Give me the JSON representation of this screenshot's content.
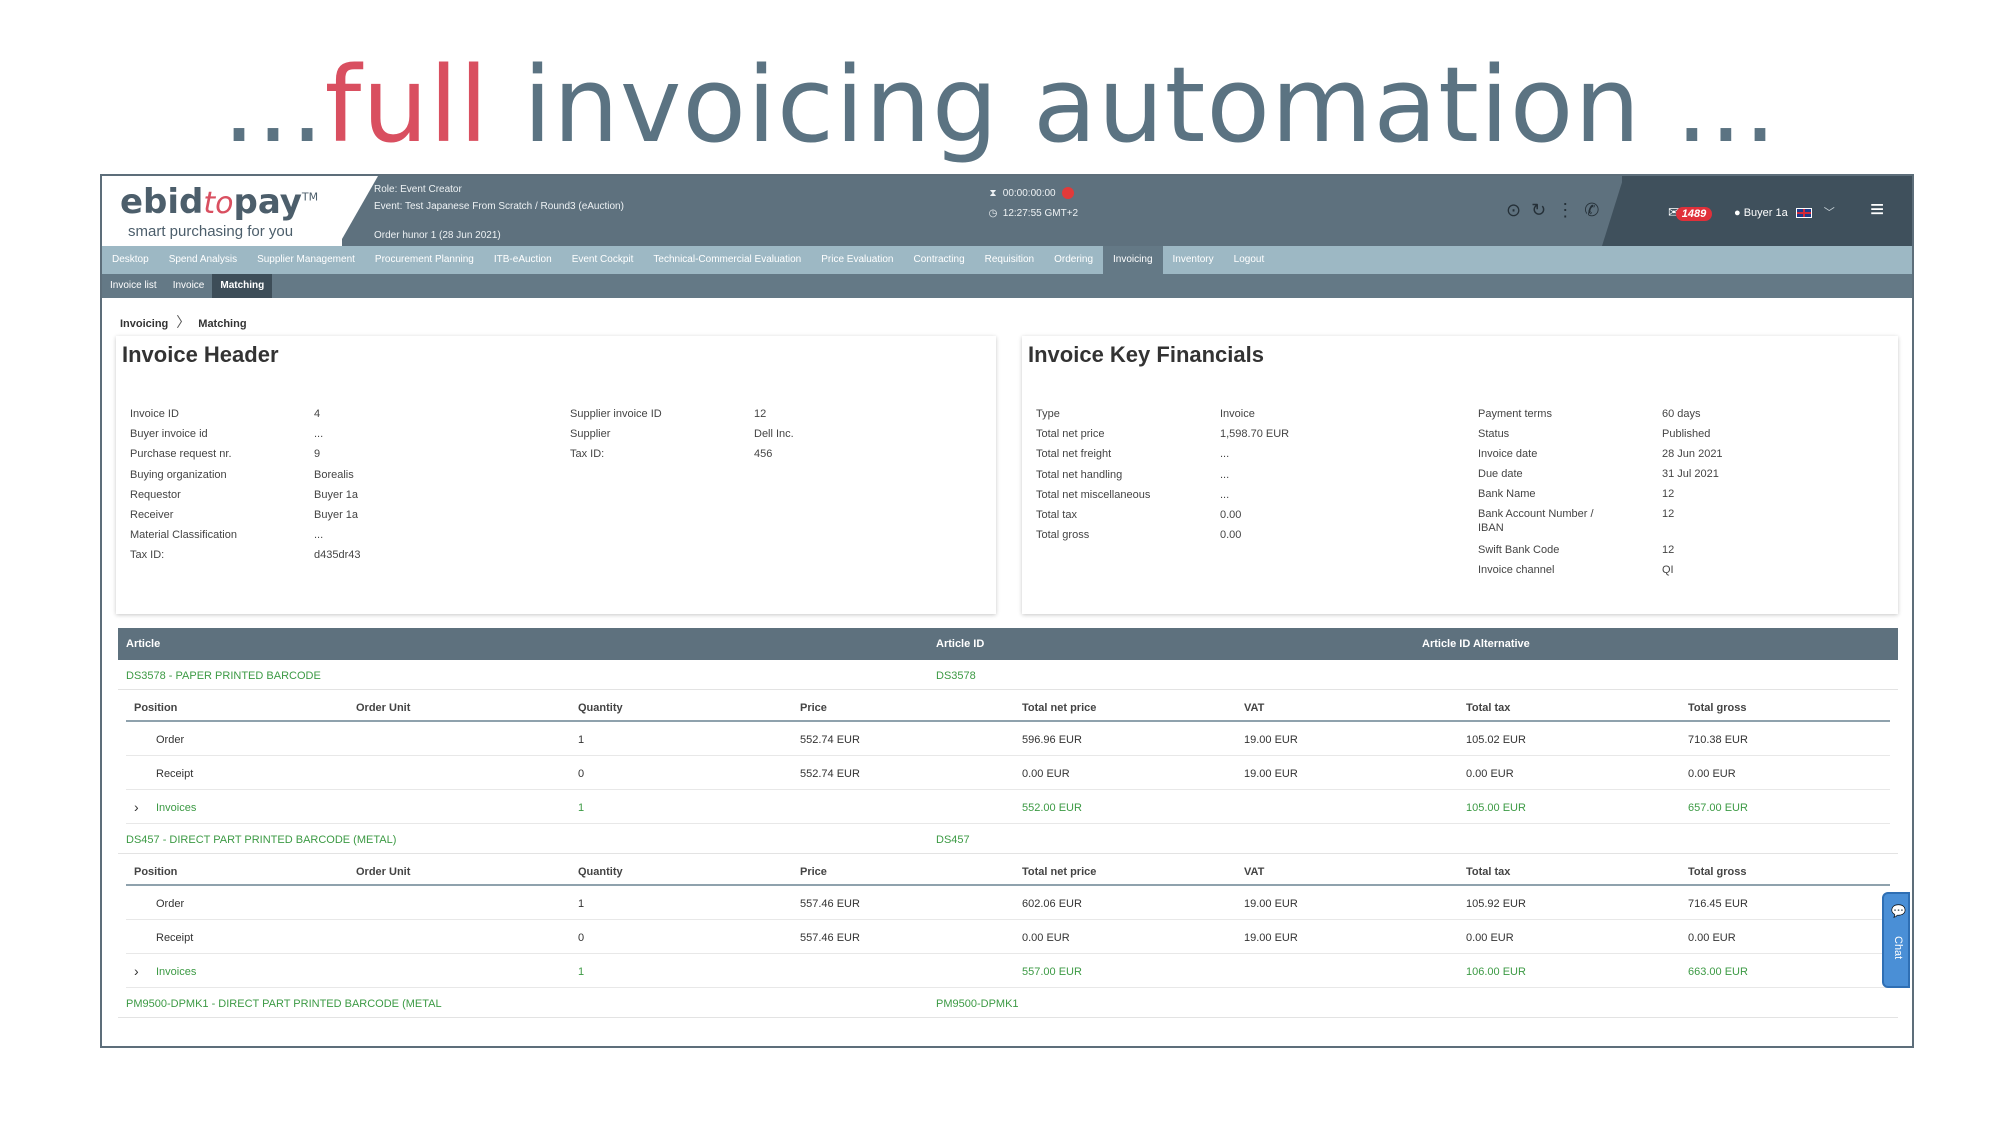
{
  "slide": {
    "title_prefix": "...",
    "title_accent": "full",
    "title_rest": " invoicing automation ..."
  },
  "colors": {
    "accent": "#d94f60",
    "title": "#5b7382",
    "header_bg": "#5e717e",
    "nav_bg": "#9db8c4",
    "green_text": "#3c9a44",
    "badge": "#e0303a"
  },
  "header": {
    "logo_part1": "ebid",
    "logo_part2": "to",
    "logo_part3": "pay",
    "logo_tm": "TM",
    "tagline": "smart purchasing for you",
    "role": "Role:  Event Creator",
    "event": "Event:  Test Japanese From Scratch / Round3 (eAuction)",
    "order": "Order  hunor 1 (28 Jun 2021)",
    "timer": "00:00:00:00",
    "clock": "12:27:55 GMT+2",
    "mail_count": "1489",
    "user_name": "Buyer 1a"
  },
  "nav": {
    "items": [
      "Desktop",
      "Spend Analysis",
      "Supplier Management",
      "Procurement Planning",
      "ITB-eAuction",
      "Event Cockpit",
      "Technical-Commercial Evaluation",
      "Price Evaluation",
      "Contracting",
      "Requisition",
      "Ordering",
      "Invoicing",
      "Inventory",
      "Logout"
    ],
    "active": "Invoicing"
  },
  "subnav": {
    "items": [
      "Invoice list",
      "Invoice",
      "Matching"
    ],
    "active": "Matching"
  },
  "breadcrumb": {
    "parent": "Invoicing",
    "current": "Matching"
  },
  "invoice_header": {
    "title": "Invoice Header",
    "left": [
      {
        "label": "Invoice ID",
        "value": "4"
      },
      {
        "label": "Buyer invoice id",
        "value": "..."
      },
      {
        "label": "Purchase request nr.",
        "value": "9"
      },
      {
        "label": "Buying organization",
        "value": "Borealis"
      },
      {
        "label": "Requestor",
        "value": "Buyer 1a"
      },
      {
        "label": "Receiver",
        "value": "Buyer 1a"
      },
      {
        "label": "Material Classification",
        "value": "..."
      },
      {
        "label": "Tax ID:",
        "value": "d435dr43"
      }
    ],
    "right": [
      {
        "label": "Supplier invoice ID",
        "value": "12"
      },
      {
        "label": "Supplier",
        "value": "Dell Inc."
      },
      {
        "label": "Tax ID:",
        "value": "456"
      }
    ]
  },
  "key_financials": {
    "title": "Invoice Key Financials",
    "left": [
      {
        "label": "Type",
        "value": "Invoice"
      },
      {
        "label": "Total net price",
        "value": "1,598.70 EUR"
      },
      {
        "label": "Total net freight",
        "value": "..."
      },
      {
        "label": "Total net handling",
        "value": "..."
      },
      {
        "label": "Total net miscellaneous",
        "value": "..."
      },
      {
        "label": "Total tax",
        "value": "0.00"
      },
      {
        "label": "Total gross",
        "value": "0.00"
      }
    ],
    "right": [
      {
        "label": "Payment terms",
        "value": "60 days"
      },
      {
        "label": "Status",
        "value": "Published"
      },
      {
        "label": "Invoice date",
        "value": "28 Jun 2021"
      },
      {
        "label": "Due date",
        "value": "31 Jul 2021"
      },
      {
        "label": "Bank Name",
        "value": "12"
      },
      {
        "label": "Bank Account Number /",
        "value": "12"
      },
      {
        "label": "IBAN",
        "value": ""
      },
      {
        "label": "Swift Bank Code",
        "value": "12"
      },
      {
        "label": "Invoice channel",
        "value": "QI"
      }
    ]
  },
  "articles_table": {
    "columns": [
      "Article",
      "Article ID",
      "Article ID Alternative"
    ],
    "position_columns": [
      "Position",
      "Order Unit",
      "Quantity",
      "Price",
      "Total net price",
      "VAT",
      "Total tax",
      "Total gross"
    ],
    "articles": [
      {
        "name": "DS3578 - PAPER PRINTED BARCODE",
        "id": "DS3578",
        "rows": [
          {
            "position": "Order",
            "unit": "",
            "qty": "1",
            "price": "552.74 EUR",
            "net": "596.96 EUR",
            "vat": "19.00 EUR",
            "tax": "105.02 EUR",
            "gross": "710.38 EUR"
          },
          {
            "position": "Receipt",
            "unit": "",
            "qty": "0",
            "price": "552.74 EUR",
            "net": "0.00 EUR",
            "vat": "19.00 EUR",
            "tax": "0.00 EUR",
            "gross": "0.00 EUR"
          },
          {
            "position": "Invoices",
            "unit": "",
            "qty": "1",
            "price": "",
            "net": "552.00 EUR",
            "vat": "",
            "tax": "105.00 EUR",
            "gross": "657.00 EUR"
          }
        ]
      },
      {
        "name": "DS457 - DIRECT PART PRINTED BARCODE (METAL)",
        "id": "DS457",
        "rows": [
          {
            "position": "Order",
            "unit": "",
            "qty": "1",
            "price": "557.46 EUR",
            "net": "602.06 EUR",
            "vat": "19.00 EUR",
            "tax": "105.92 EUR",
            "gross": "716.45 EUR"
          },
          {
            "position": "Receipt",
            "unit": "",
            "qty": "0",
            "price": "557.46 EUR",
            "net": "0.00 EUR",
            "vat": "19.00 EUR",
            "tax": "0.00 EUR",
            "gross": "0.00 EUR"
          },
          {
            "position": "Invoices",
            "unit": "",
            "qty": "1",
            "price": "",
            "net": "557.00 EUR",
            "vat": "",
            "tax": "106.00 EUR",
            "gross": "663.00 EUR"
          }
        ]
      },
      {
        "name": "PM9500-DPMK1 - DIRECT PART PRINTED BARCODE (METAL",
        "id": "PM9500-DPMK1",
        "rows": []
      }
    ]
  },
  "chat": {
    "label": "Chat"
  }
}
